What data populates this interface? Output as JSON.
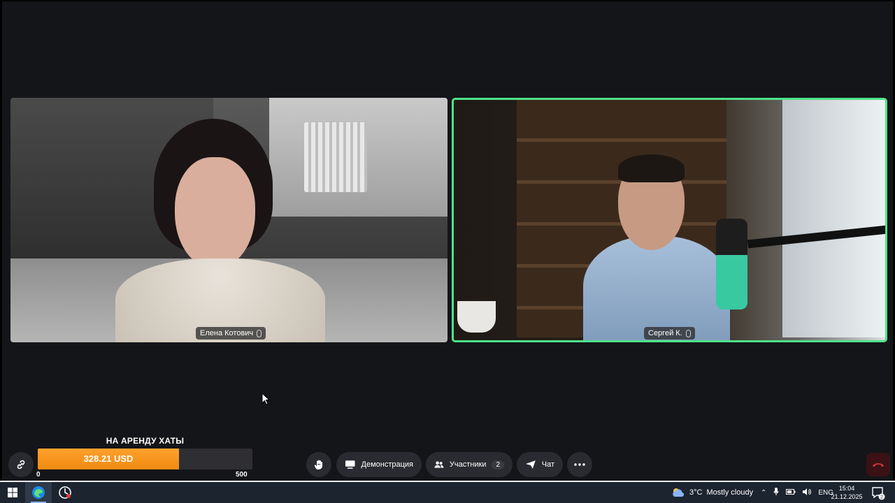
{
  "participants": [
    {
      "name": "Елена Котович"
    },
    {
      "name": "Сергей К."
    }
  ],
  "goal": {
    "title": "НА АРЕНДУ ХАТЫ",
    "amount": "328.21 USD",
    "progress_fraction": 0.6564,
    "min_label": "0",
    "max_label": "500",
    "fill_color": "#f7931a"
  },
  "toolbar": {
    "link_icon": "link-icon",
    "raise_hand_icon": "hand-icon",
    "demo_label": "Демонстрация",
    "participants_label": "Участники",
    "participants_count": "2",
    "chat_label": "Чат",
    "more_icon": "more-dots-icon",
    "end_call_icon": "phone-hangup-icon"
  },
  "colors": {
    "active_speaker_border": "#4ee38a",
    "background": "#141518",
    "end_call": "#d13438"
  },
  "taskbar": {
    "weather_temp": "3°C",
    "weather_text": "Mostly cloudy",
    "language": "ENG",
    "time": "15:04",
    "date": "21.12.2025",
    "notification_count": "2"
  }
}
